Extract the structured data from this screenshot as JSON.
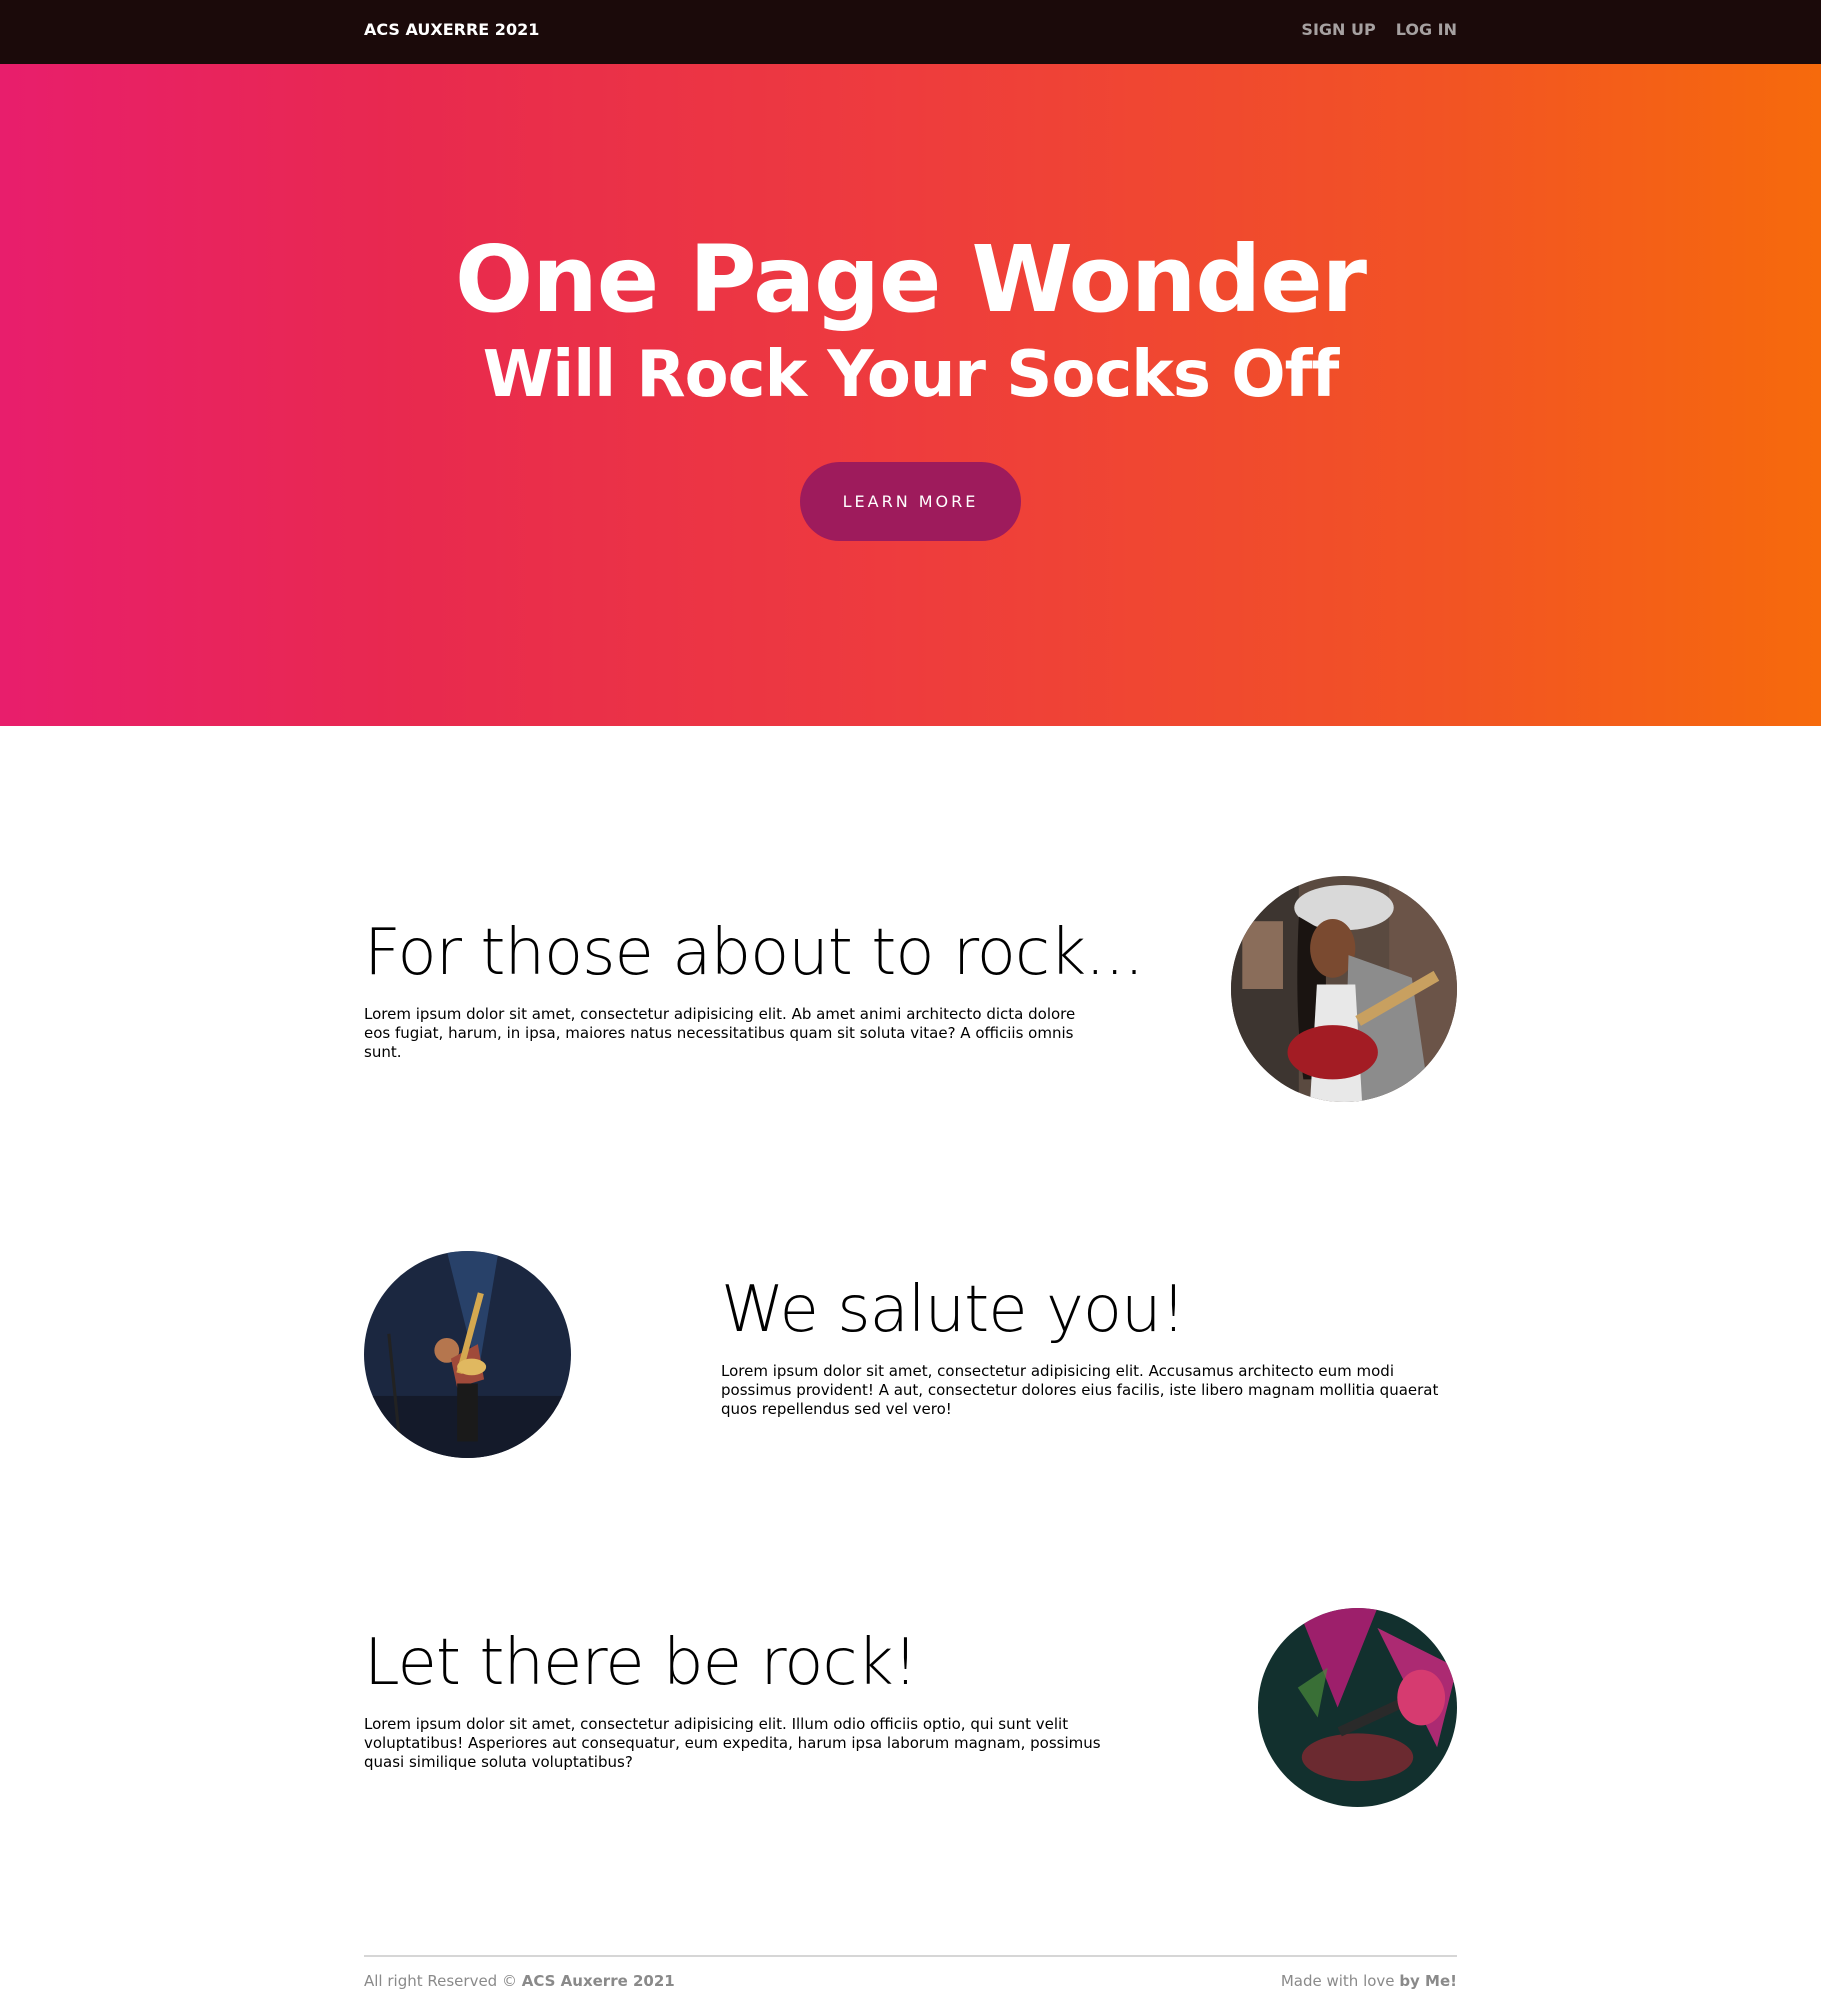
{
  "navbar": {
    "brand": "ACS AUXERRE 2021",
    "links": [
      {
        "label": "SIGN UP"
      },
      {
        "label": "LOG IN"
      }
    ]
  },
  "hero": {
    "title": "One Page Wonder",
    "subtitle": "Will Rock Your Socks Off",
    "button_label": "LEARN MORE",
    "gradient_colors": [
      "#e81e6c",
      "#f66a0c"
    ],
    "button_color": "#9e1b5c"
  },
  "sections": [
    {
      "title": "For those about to rock...",
      "text": "Lorem ipsum dolor sit amet, consectetur adipisicing elit. Ab amet animi architecto dicta dolore eos fugiat, harum, in ipsa, maiores natus necessitatibus quam sit soluta vitae? A officiis omnis sunt."
    },
    {
      "title": "We salute you!",
      "text": "Lorem ipsum dolor sit amet, consectetur adipisicing elit. Accusamus architecto eum modi possimus provident! A aut, consectetur dolores eius facilis, iste libero magnam mollitia quaerat quos repellendus sed vel vero!"
    },
    {
      "title": "Let there be rock!",
      "text": "Lorem ipsum dolor sit amet, consectetur adipisicing elit. Illum odio officiis optio, qui sunt velit voluptatibus! Asperiores aut consequatur, eum expedita, harum ipsa laborum magnam, possimus quasi similique soluta voluptatibus?"
    }
  ],
  "footer": {
    "left_prefix": "All right Reserved ©",
    "left_bold": "ACS Auxerre 2021",
    "right_prefix": "Made with love",
    "right_bold": "by Me!"
  }
}
